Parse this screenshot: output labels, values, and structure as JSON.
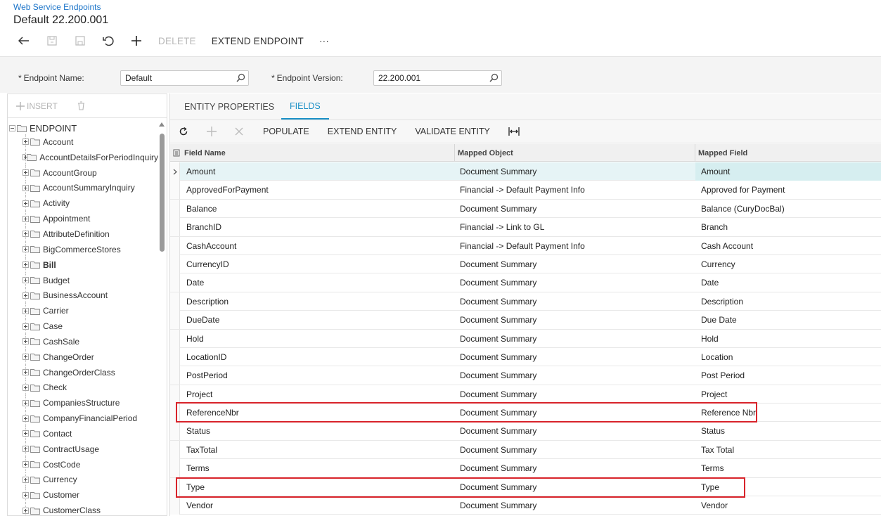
{
  "header": {
    "breadcrumb": "Web Service Endpoints",
    "title": "Default 22.200.001"
  },
  "toolbar": {
    "delete_label": "DELETE",
    "extend_endpoint_label": "EXTEND ENDPOINT",
    "more_label": "···"
  },
  "form": {
    "endpoint_name_label": "Endpoint Name:",
    "endpoint_name_value": "Default",
    "endpoint_version_label": "Endpoint Version:",
    "endpoint_version_value": "22.200.001",
    "required_marker": "*"
  },
  "tree": {
    "insert_label": "INSERT",
    "root_label": "ENDPOINT",
    "items": [
      {
        "label": "Account"
      },
      {
        "label": "AccountDetailsForPeriodInquiry"
      },
      {
        "label": "AccountGroup"
      },
      {
        "label": "AccountSummaryInquiry"
      },
      {
        "label": "Activity"
      },
      {
        "label": "Appointment"
      },
      {
        "label": "AttributeDefinition"
      },
      {
        "label": "BigCommerceStores"
      },
      {
        "label": "Bill"
      },
      {
        "label": "Budget"
      },
      {
        "label": "BusinessAccount"
      },
      {
        "label": "Carrier"
      },
      {
        "label": "Case"
      },
      {
        "label": "CashSale"
      },
      {
        "label": "ChangeOrder"
      },
      {
        "label": "ChangeOrderClass"
      },
      {
        "label": "Check"
      },
      {
        "label": "CompaniesStructure"
      },
      {
        "label": "CompanyFinancialPeriod"
      },
      {
        "label": "Contact"
      },
      {
        "label": "ContractUsage"
      },
      {
        "label": "CostCode"
      },
      {
        "label": "Currency"
      },
      {
        "label": "Customer"
      },
      {
        "label": "CustomerClass"
      }
    ]
  },
  "tabs": {
    "entity_properties": "ENTITY PROPERTIES",
    "fields": "FIELDS"
  },
  "grid_toolbar": {
    "populate": "POPULATE",
    "extend_entity": "EXTEND ENTITY",
    "validate_entity": "VALIDATE ENTITY"
  },
  "grid": {
    "columns": {
      "field_name": "Field Name",
      "mapped_object": "Mapped Object",
      "mapped_field": "Mapped Field"
    },
    "rows": [
      {
        "field": "Amount",
        "object": "Document Summary",
        "mapped": "Amount"
      },
      {
        "field": "ApprovedForPayment",
        "object": "Financial -> Default Payment Info",
        "mapped": "Approved for Payment"
      },
      {
        "field": "Balance",
        "object": "Document Summary",
        "mapped": "Balance (CuryDocBal)"
      },
      {
        "field": "BranchID",
        "object": "Financial -> Link to GL",
        "mapped": "Branch"
      },
      {
        "field": "CashAccount",
        "object": "Financial -> Default Payment Info",
        "mapped": "Cash Account"
      },
      {
        "field": "CurrencyID",
        "object": "Document Summary",
        "mapped": "Currency"
      },
      {
        "field": "Date",
        "object": "Document Summary",
        "mapped": "Date"
      },
      {
        "field": "Description",
        "object": "Document Summary",
        "mapped": "Description"
      },
      {
        "field": "DueDate",
        "object": "Document Summary",
        "mapped": "Due Date"
      },
      {
        "field": "Hold",
        "object": "Document Summary",
        "mapped": "Hold"
      },
      {
        "field": "LocationID",
        "object": "Document Summary",
        "mapped": "Location"
      },
      {
        "field": "PostPeriod",
        "object": "Document Summary",
        "mapped": "Post Period"
      },
      {
        "field": "Project",
        "object": "Document Summary",
        "mapped": "Project"
      },
      {
        "field": "ReferenceNbr",
        "object": "Document Summary",
        "mapped": "Reference Nbr."
      },
      {
        "field": "Status",
        "object": "Document Summary",
        "mapped": "Status"
      },
      {
        "field": "TaxTotal",
        "object": "Document Summary",
        "mapped": "Tax Total"
      },
      {
        "field": "Terms",
        "object": "Document Summary",
        "mapped": "Terms"
      },
      {
        "field": "Type",
        "object": "Document Summary",
        "mapped": "Type"
      },
      {
        "field": "Vendor",
        "object": "Document Summary",
        "mapped": "Vendor"
      }
    ]
  },
  "colors": {
    "accent": "#1a8fc6",
    "link": "#1a73c8",
    "highlight": "#d8232a",
    "selected_row": "#e6f4f6"
  }
}
